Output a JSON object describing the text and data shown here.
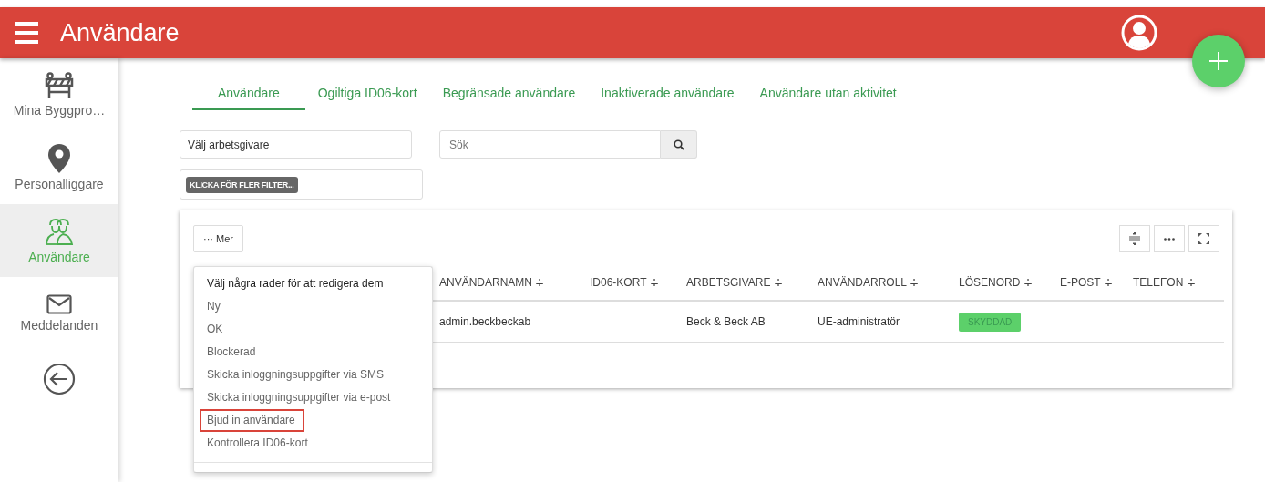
{
  "header": {
    "title": "Användare"
  },
  "sidebar": {
    "items": [
      {
        "label": "Mina Byggpro…",
        "selected": false
      },
      {
        "label": "Personalliggare",
        "selected": false
      },
      {
        "label": "Användare",
        "selected": true
      },
      {
        "label": "Meddelanden",
        "selected": false
      }
    ]
  },
  "tabs": [
    {
      "label": "Användare",
      "selected": true
    },
    {
      "label": "Ogiltiga ID06-kort",
      "selected": false
    },
    {
      "label": "Begränsade användare",
      "selected": false
    },
    {
      "label": "Inaktiverade användare",
      "selected": false
    },
    {
      "label": "Användare utan aktivitet",
      "selected": false
    }
  ],
  "filters": {
    "employer": {
      "value": "Välj arbetsgivare"
    },
    "search": {
      "placeholder": "Sök"
    },
    "more_filters": "KLICKA FÖR FLER FILTER..."
  },
  "table": {
    "more_button": "··· Mer",
    "columns": [
      "ANVÄNDARNAMN ≑",
      "ID06-KORT ≑",
      "ARBETSGIVARE ≑",
      "ANVÄNDARROLL ≑",
      "LÖSENORD ≑",
      "E-POST ≑",
      "TELEFON ≑"
    ],
    "rows": [
      {
        "cells": [
          "admin.beckbeckab",
          null,
          "Beck & Beck AB",
          "UE-administratör",
          {
            "kind": "badge",
            "text": "SKYDDAD"
          },
          null,
          null
        ]
      }
    ]
  },
  "menu": {
    "items": [
      {
        "label": "Välj några rader för att redigera dem",
        "kind": "header",
        "highlighted": false
      },
      {
        "label": "Ny",
        "kind": "item",
        "highlighted": false
      },
      {
        "label": "OK",
        "kind": "item",
        "highlighted": false
      },
      {
        "label": "Blockerad",
        "kind": "item",
        "highlighted": false
      },
      {
        "label": "Skicka inloggningsuppgifter via SMS",
        "kind": "item",
        "highlighted": false
      },
      {
        "label": "Skicka inloggningsuppgifter via e-post",
        "kind": "item",
        "highlighted": false
      },
      {
        "label": "Bjud in användare",
        "kind": "item",
        "highlighted": true
      },
      {
        "label": "Kontrollera ID06-kort",
        "kind": "item",
        "highlighted": false
      }
    ]
  }
}
